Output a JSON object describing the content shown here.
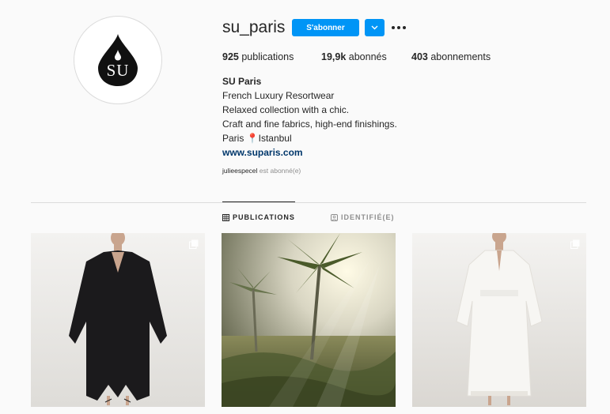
{
  "profile": {
    "username": "su_paris",
    "avatar_text": "SU",
    "follow_label": "S'abonner",
    "icons": {
      "dropdown": "chevron-down-icon",
      "more": "more-options-icon"
    },
    "accent_color": "#0095f6"
  },
  "stats": {
    "posts_count": "925",
    "posts_label": "publications",
    "followers_count": "19,9k",
    "followers_label": "abonnés",
    "following_count": "403",
    "following_label": "abonnements"
  },
  "bio": {
    "name": "SU Paris",
    "lines": [
      "French Luxury Resortwear",
      "Relaxed collection with a chic.",
      "Craft and fine fabrics, high-end finishings.",
      "Paris 📍Istanbul"
    ],
    "website": "www.suparis.com"
  },
  "followed_by": {
    "user": "julieespecel",
    "text": "est abonné(e)"
  },
  "tabs": [
    {
      "label": "PUBLICATIONS",
      "icon": "grid-icon",
      "active": true
    },
    {
      "label": "IDENTIFIÉ(E)",
      "icon": "tag-icon",
      "active": false
    }
  ],
  "posts": [
    {
      "subject": "black-kaftan-dress",
      "multiple": true
    },
    {
      "subject": "palm-trees-sunlight",
      "multiple": false
    },
    {
      "subject": "white-kaftan-dress",
      "multiple": true
    }
  ]
}
